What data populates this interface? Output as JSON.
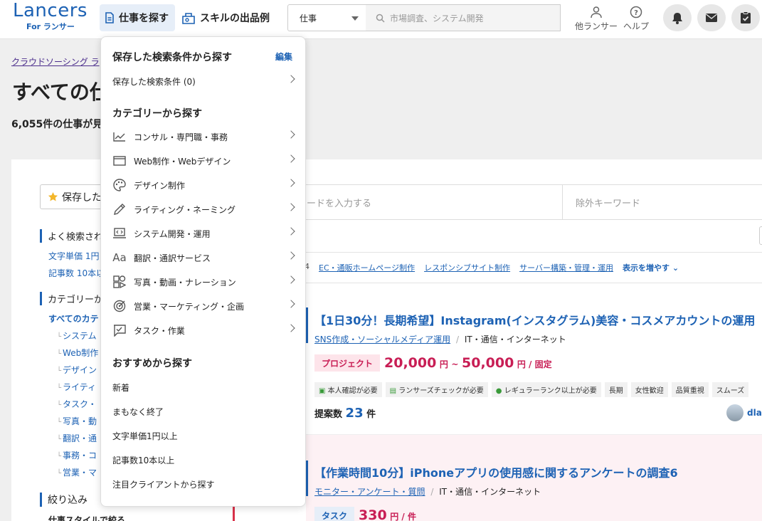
{
  "header": {
    "logo_main": "Lancers",
    "logo_sub": "For ランサー",
    "nav_find": "仕事を探す",
    "nav_skill": "スキルの出品例",
    "search_select": "仕事",
    "search_placeholder": "市場調査、システム開発",
    "other_lancer": "他ランサー",
    "help": "ヘルプ"
  },
  "page": {
    "breadcrumb": "クラウドソーシング ラ",
    "title": "すべての仕",
    "count": "6,055件の仕事が見"
  },
  "sidebar": {
    "saved_button": "保存した",
    "popular_head": "よく検索され",
    "popular_links": [
      "文字単価 1円",
      "記事数 10本以"
    ],
    "category_head": "カテゴリーか",
    "all_categories": "すべてのカテ",
    "subcategories": [
      "システム",
      "Web制作",
      "デザイン",
      "ライティ",
      "タスク・",
      "写真・動",
      "翻訳・通",
      "事務・コ",
      "営業・マ"
    ],
    "filter_head": "絞り込み",
    "work_style": "仕事スタイルで絞る"
  },
  "keyword": {
    "include_placeholder": "ードを入力する",
    "exclude_placeholder": "除外キーワード"
  },
  "tags": {
    "items": [
      "EC・通販ホームページ制作",
      "レスポンシブサイト制作",
      "サーバー構築・管理・運用"
    ],
    "more": "表示を増やす"
  },
  "jobs": [
    {
      "title": "【1日30分！長期希望】Instagram(インスタグラム)美容・コスメアカウントの運用",
      "category": "SNS作成・ソーシャルメディア運用",
      "industry": "IT・通信・インターネット",
      "type": "プロジェクト",
      "price_min": "20,000",
      "price_max": "50,000",
      "price_unit": "円",
      "price_tail": "円 / 固定",
      "tilde": "~",
      "chips": [
        "本人確認が必要",
        "ランサーズチェックが必要",
        "レギュラーランク以上が必要",
        "長期",
        "女性歓迎",
        "品質重視",
        "スムーズ"
      ],
      "proposals_label": "提案数",
      "proposals": "23",
      "proposals_unit": "件",
      "user": "dlar"
    },
    {
      "title": "【作業時間10分】iPhoneアプリの使用感に関するアンケートの調査6",
      "category": "モニター・アンケート・質問",
      "industry": "IT・通信・インターネット",
      "type": "タスク",
      "price": "330",
      "price_tail": "円 / 件"
    }
  ],
  "dropdown": {
    "saved_head": "保存した検索条件から探す",
    "edit": "編集",
    "saved_item": "保存した検索条件 (0)",
    "category_head": "カテゴリーから探す",
    "categories": [
      "コンサル・専門職・事務",
      "Web制作・Webデザイン",
      "デザイン制作",
      "ライティング・ネーミング",
      "システム開発・運用",
      "翻訳・通訳サービス",
      "写真・動画・ナレーション",
      "営業・マーケティング・企画",
      "タスク・作業"
    ],
    "recommend_head": "おすすめから探す",
    "recommend": [
      "新着",
      "まもなく終了",
      "文字単価1円以上",
      "記事数10本以上",
      "注目クライアントから探す"
    ]
  }
}
